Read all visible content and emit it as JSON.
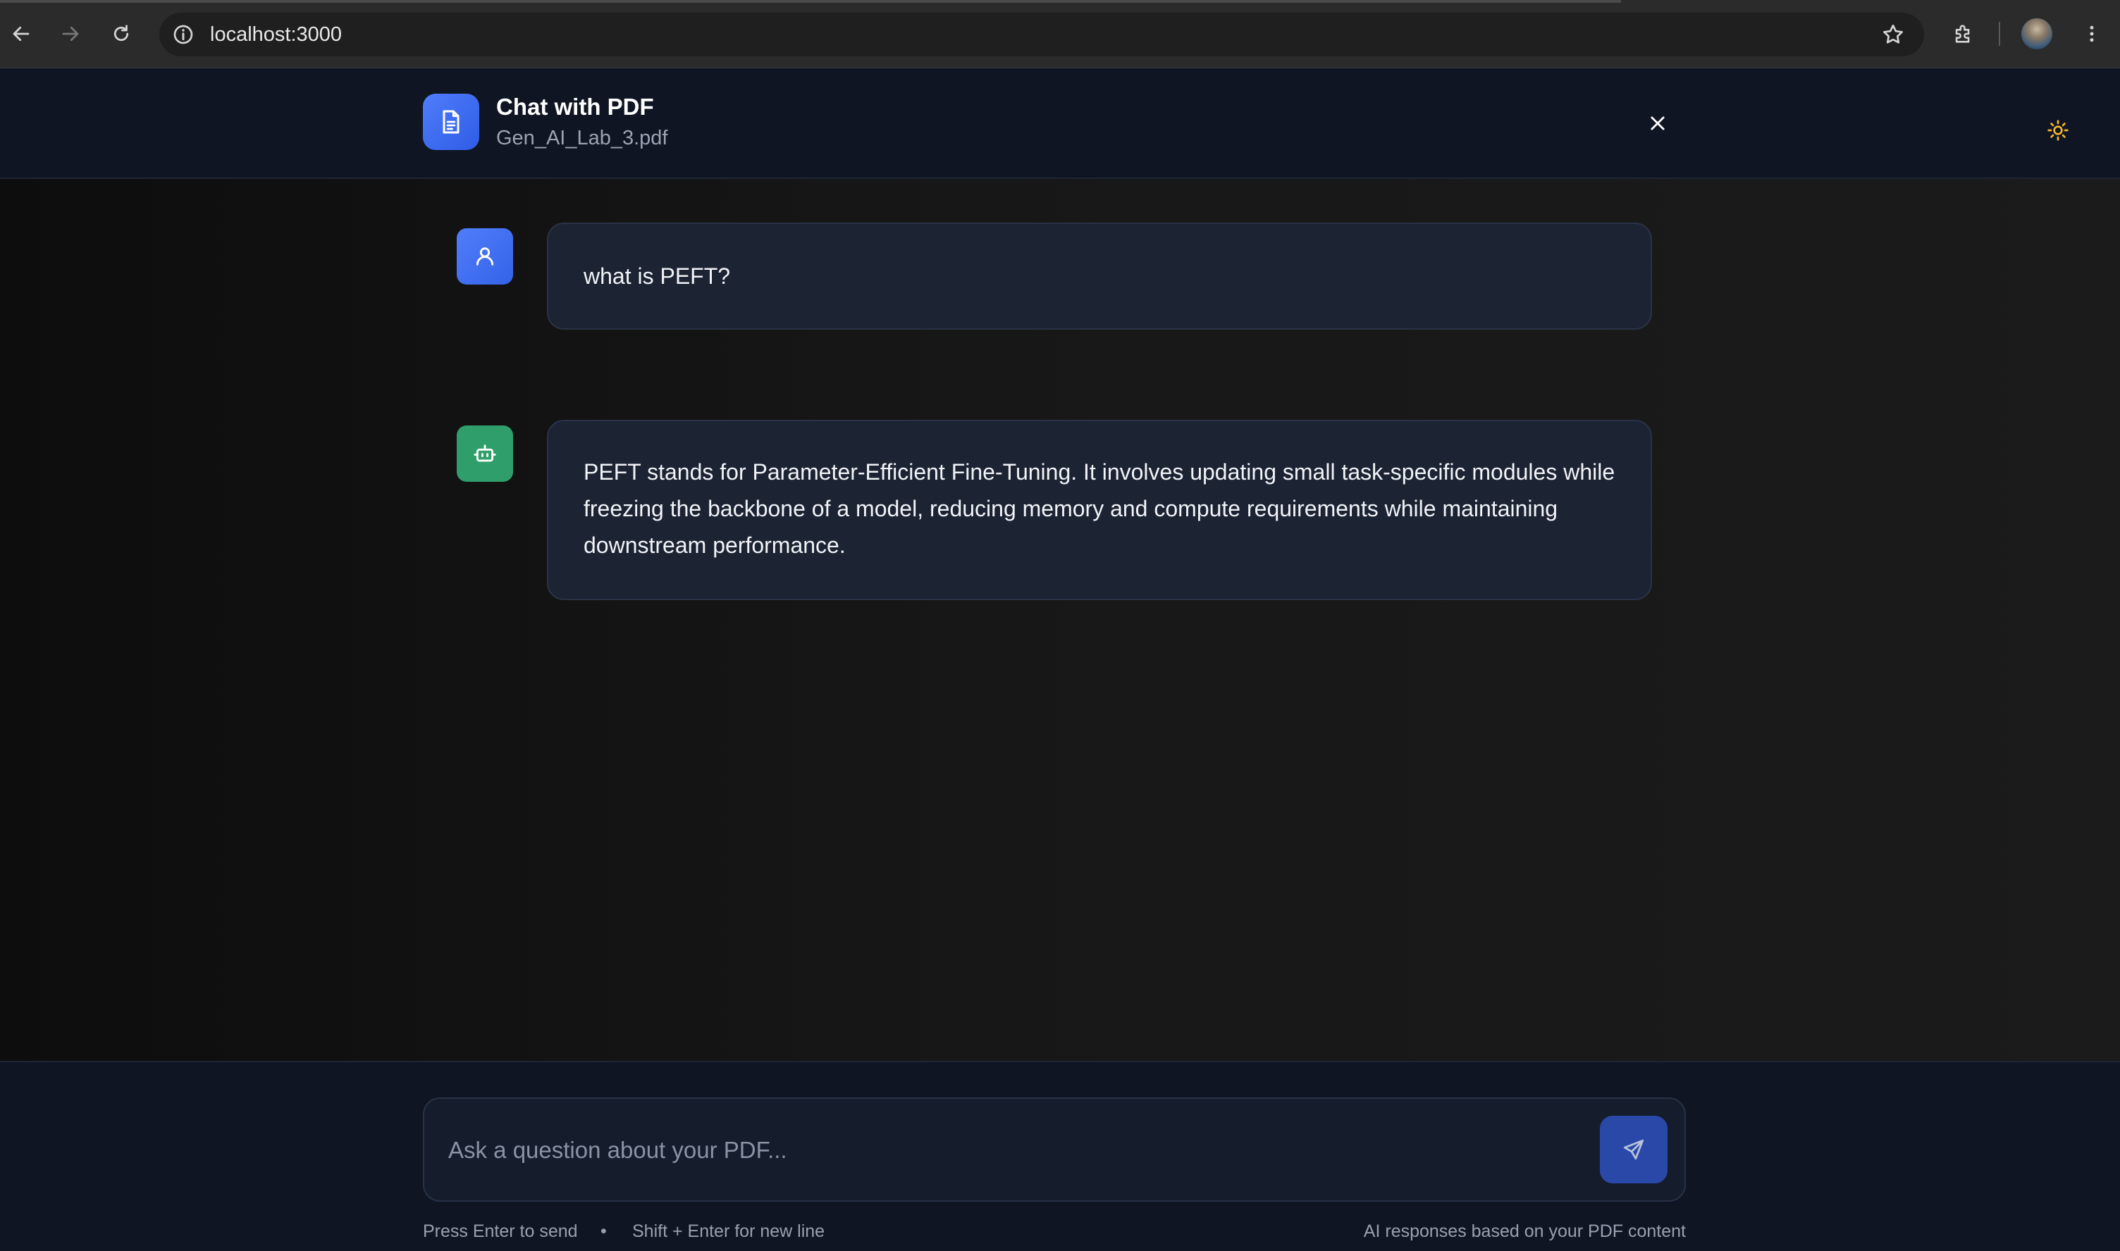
{
  "browser": {
    "url": "localhost:3000",
    "icons": [
      "back-arrow-icon",
      "forward-arrow-icon",
      "reload-icon",
      "site-info-icon",
      "bookmark-star-icon",
      "extensions-puzzle-icon",
      "profile-avatar",
      "more-vert-icon"
    ]
  },
  "header": {
    "title": "Chat with PDF",
    "filename": "Gen_AI_Lab_3.pdf",
    "icons": [
      "document-icon",
      "close-icon",
      "sun-icon"
    ]
  },
  "messages": [
    {
      "role": "user",
      "avatar_icon": "user-icon",
      "text": "what is PEFT?"
    },
    {
      "role": "assistant",
      "avatar_icon": "bot-icon",
      "text": "PEFT stands for Parameter-Efficient Fine-Tuning. It involves updating small task-specific modules while freezing the backbone of a model, reducing memory and compute requirements while maintaining downstream performance."
    }
  ],
  "composer": {
    "placeholder": "Ask a question about your PDF...",
    "send_icon": "send-icon",
    "hint_enter": "Press Enter to send",
    "hint_separator": "•",
    "hint_shift": "Shift + Enter for new line",
    "hint_right": "AI responses based on your PDF content"
  },
  "colors": {
    "accent_blue": "#3b6ef0",
    "bot_green": "#2f9e6a",
    "sun_yellow": "#f5b82e",
    "header_bg": "#0f1522",
    "bubble_bg": "#1c2333"
  }
}
